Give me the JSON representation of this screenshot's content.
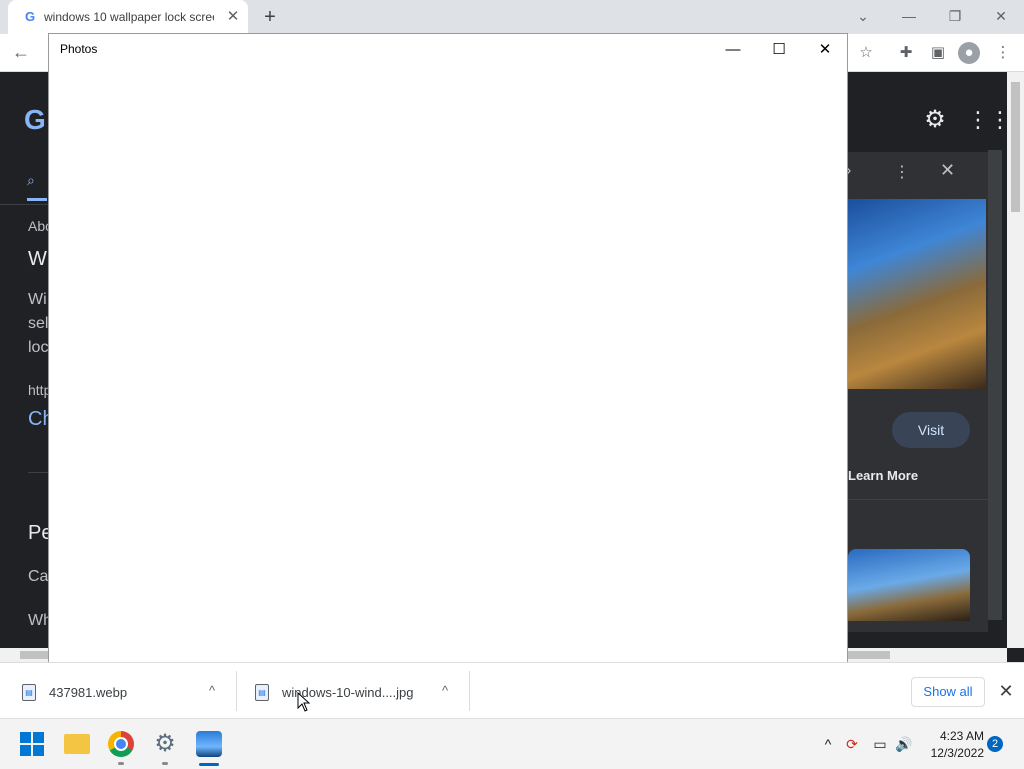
{
  "browser": {
    "tab_title": "windows 10 wallpaper lock scree",
    "tab_favicon": "G",
    "tab_close": "✕",
    "new_tab": "+",
    "back": "←",
    "star": "☆",
    "menu": "⋮"
  },
  "page": {
    "logo": "G",
    "left_fragments": [
      "Abo",
      "W",
      "Wi",
      "sel",
      "loc",
      "http",
      "Ch",
      "Pe",
      "Ca",
      "Wh"
    ],
    "visit_label": "Visit",
    "learn_more": "Learn More"
  },
  "photos_window": {
    "title": "Photos",
    "minimize": "—",
    "maximize": "☐",
    "close": "✕"
  },
  "downloads": {
    "items": [
      {
        "name": "437981.webp"
      },
      {
        "name": "windows-10-wind....jpg"
      }
    ],
    "show_all": "Show all",
    "close": "✕",
    "caret": "^"
  },
  "taskbar": {
    "time": "4:23 AM",
    "date": "12/3/2022",
    "notification_count": "2",
    "tray_chevron": "^",
    "volume": "🔊"
  },
  "colors": {
    "accent": "#0067c0",
    "link": "#1a73e8",
    "page_bg": "#202124"
  }
}
